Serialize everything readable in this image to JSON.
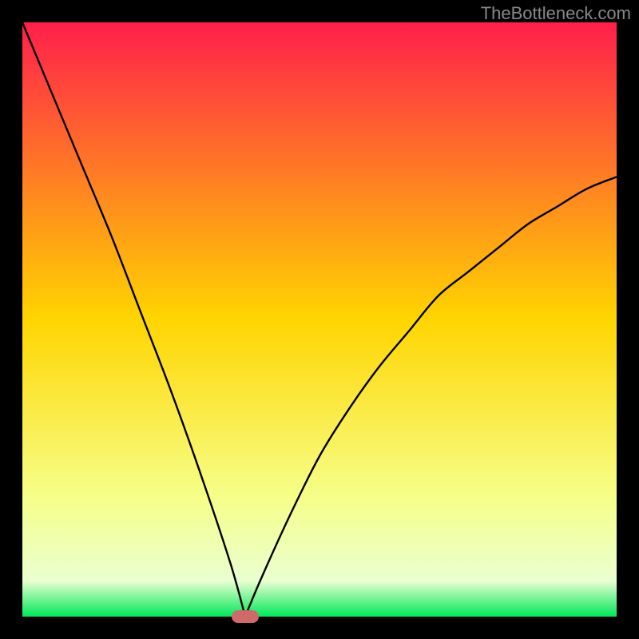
{
  "watermark": "TheBottleneck.com",
  "chart_data": {
    "type": "line",
    "title": "",
    "xlabel": "",
    "ylabel": "",
    "xlim": [
      0,
      1
    ],
    "ylim": [
      0,
      1
    ],
    "grid": false,
    "legend": false,
    "series": [
      {
        "name": "bottleneck-curve",
        "x": [
          0.0,
          0.05,
          0.1,
          0.15,
          0.2,
          0.25,
          0.3,
          0.35,
          0.375,
          0.4,
          0.45,
          0.5,
          0.55,
          0.6,
          0.65,
          0.7,
          0.75,
          0.8,
          0.85,
          0.9,
          0.95,
          1.0
        ],
        "y": [
          1.0,
          0.88,
          0.76,
          0.64,
          0.51,
          0.38,
          0.24,
          0.09,
          0.0,
          0.06,
          0.17,
          0.27,
          0.35,
          0.42,
          0.48,
          0.54,
          0.58,
          0.62,
          0.66,
          0.69,
          0.72,
          0.74
        ]
      }
    ],
    "annotations": [
      {
        "name": "min-marker",
        "x": 0.375,
        "y": 0.0
      }
    ],
    "background_gradient": {
      "stops": [
        {
          "offset": 0.0,
          "color": "#ff1f4b"
        },
        {
          "offset": 0.5,
          "color": "#ffd500"
        },
        {
          "offset": 0.8,
          "color": "#f6ff8a"
        },
        {
          "offset": 0.94,
          "color": "#eaffd0"
        },
        {
          "offset": 1.0,
          "color": "#00e85a"
        }
      ]
    }
  },
  "colors": {
    "curve": "#000000",
    "marker": "#cf6a6a",
    "frame": "#000000",
    "watermark": "#888888"
  }
}
